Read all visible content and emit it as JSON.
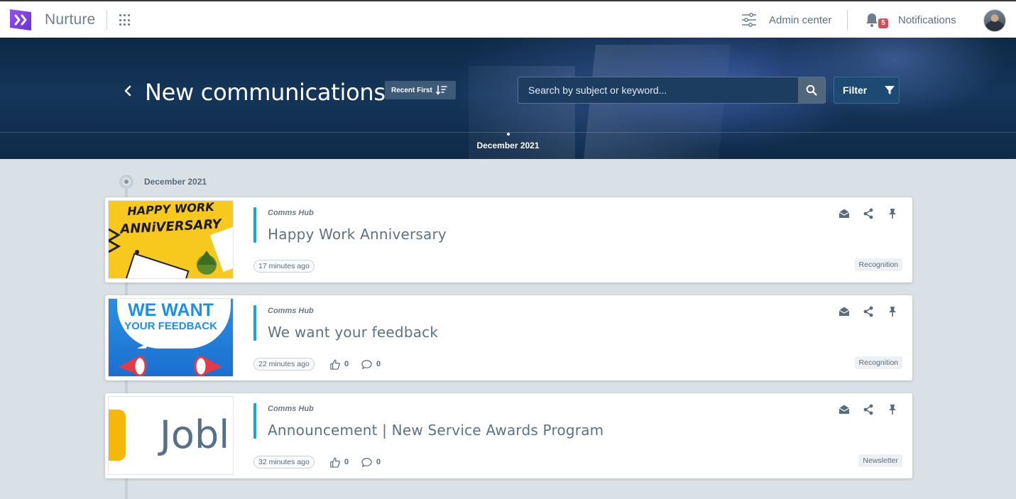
{
  "app": {
    "name": "Nurture"
  },
  "topbar": {
    "admin_label": "Admin center",
    "notifications_label": "Notifications",
    "notification_count": "5"
  },
  "header": {
    "title": "New communications",
    "sort_label": "Recent First",
    "search_placeholder": "Search by subject or keyword...",
    "filter_label": "Filter",
    "timeline_month": "December 2021"
  },
  "feed": {
    "month": "December 2021",
    "items": [
      {
        "source": "Comms Hub",
        "title": "Happy Work Anniversary",
        "time": "17 minutes ago",
        "tag": "Recognition",
        "thumb_line1": "HAPPY WORK",
        "thumb_line2": "ANNiVERSARY"
      },
      {
        "source": "Comms Hub",
        "title": "We want your feedback",
        "time": "22 minutes ago",
        "likes": "0",
        "comments": "0",
        "tag": "Recognition",
        "thumb_line1": "WE WANT",
        "thumb_line2": "YOUR FEEDBACK"
      },
      {
        "source": "Comms Hub",
        "title": "Announcement | New Service Awards Program",
        "time": "32 minutes ago",
        "likes": "0",
        "comments": "0",
        "tag": "Newsletter",
        "thumb_text": "Jobl"
      }
    ]
  },
  "colors": {
    "accent": "#1aa3d9",
    "brand": "#7b3fe4",
    "badge": "#d94a5b"
  }
}
